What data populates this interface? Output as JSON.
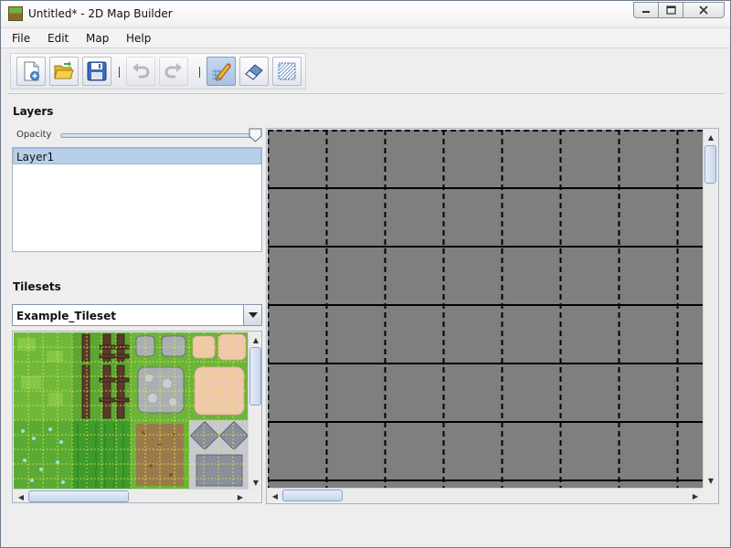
{
  "window": {
    "title": "Untitled* - 2D Map Builder",
    "controls": {
      "minimize": "—",
      "maximize": "☐",
      "close": "✕"
    }
  },
  "menubar": {
    "items": [
      "File",
      "Edit",
      "Map",
      "Help"
    ]
  },
  "toolbar": {
    "buttons": [
      {
        "name": "new-map",
        "icon": "new-document-icon",
        "enabled": true
      },
      {
        "name": "open-map",
        "icon": "folder-open-icon",
        "enabled": true
      },
      {
        "name": "save-map",
        "icon": "floppy-disk-icon",
        "enabled": true
      },
      {
        "name": "undo",
        "icon": "undo-arrow-icon",
        "enabled": false
      },
      {
        "name": "redo",
        "icon": "redo-arrow-icon",
        "enabled": false
      },
      {
        "name": "pencil-tool",
        "icon": "pencil-icon",
        "enabled": true,
        "selected": true
      },
      {
        "name": "eraser-tool",
        "icon": "eraser-icon",
        "enabled": true
      },
      {
        "name": "fill-tool",
        "icon": "hatched-fill-icon",
        "enabled": true
      }
    ]
  },
  "layers": {
    "title": "Layers",
    "opacity_label": "Opacity",
    "opacity_value": 1.0,
    "items": [
      {
        "label": "Layer1",
        "selected": true
      }
    ]
  },
  "tilesets": {
    "title": "Tilesets",
    "selected": "Example_Tileset"
  },
  "map": {
    "grid_style": "dashed-vertical-solid-horizontal",
    "background_color": "#7f7f7f"
  },
  "colors": {
    "selection": "#b8cfe9",
    "map_background": "#7f7f7f"
  }
}
